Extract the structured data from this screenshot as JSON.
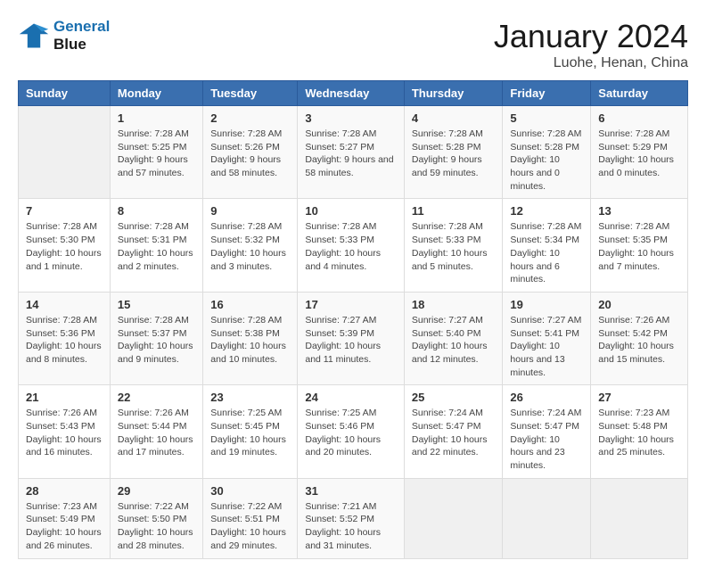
{
  "logo": {
    "line1": "General",
    "line2": "Blue"
  },
  "title": "January 2024",
  "location": "Luohe, Henan, China",
  "weekdays": [
    "Sunday",
    "Monday",
    "Tuesday",
    "Wednesday",
    "Thursday",
    "Friday",
    "Saturday"
  ],
  "weeks": [
    [
      {
        "day": null,
        "info": null
      },
      {
        "day": "1",
        "sunrise": "7:28 AM",
        "sunset": "5:25 PM",
        "daylight": "9 hours and 57 minutes."
      },
      {
        "day": "2",
        "sunrise": "7:28 AM",
        "sunset": "5:26 PM",
        "daylight": "9 hours and 58 minutes."
      },
      {
        "day": "3",
        "sunrise": "7:28 AM",
        "sunset": "5:27 PM",
        "daylight": "9 hours and 58 minutes."
      },
      {
        "day": "4",
        "sunrise": "7:28 AM",
        "sunset": "5:28 PM",
        "daylight": "9 hours and 59 minutes."
      },
      {
        "day": "5",
        "sunrise": "7:28 AM",
        "sunset": "5:28 PM",
        "daylight": "10 hours and 0 minutes."
      },
      {
        "day": "6",
        "sunrise": "7:28 AM",
        "sunset": "5:29 PM",
        "daylight": "10 hours and 0 minutes."
      }
    ],
    [
      {
        "day": "7",
        "sunrise": "7:28 AM",
        "sunset": "5:30 PM",
        "daylight": "10 hours and 1 minute."
      },
      {
        "day": "8",
        "sunrise": "7:28 AM",
        "sunset": "5:31 PM",
        "daylight": "10 hours and 2 minutes."
      },
      {
        "day": "9",
        "sunrise": "7:28 AM",
        "sunset": "5:32 PM",
        "daylight": "10 hours and 3 minutes."
      },
      {
        "day": "10",
        "sunrise": "7:28 AM",
        "sunset": "5:33 PM",
        "daylight": "10 hours and 4 minutes."
      },
      {
        "day": "11",
        "sunrise": "7:28 AM",
        "sunset": "5:33 PM",
        "daylight": "10 hours and 5 minutes."
      },
      {
        "day": "12",
        "sunrise": "7:28 AM",
        "sunset": "5:34 PM",
        "daylight": "10 hours and 6 minutes."
      },
      {
        "day": "13",
        "sunrise": "7:28 AM",
        "sunset": "5:35 PM",
        "daylight": "10 hours and 7 minutes."
      }
    ],
    [
      {
        "day": "14",
        "sunrise": "7:28 AM",
        "sunset": "5:36 PM",
        "daylight": "10 hours and 8 minutes."
      },
      {
        "day": "15",
        "sunrise": "7:28 AM",
        "sunset": "5:37 PM",
        "daylight": "10 hours and 9 minutes."
      },
      {
        "day": "16",
        "sunrise": "7:28 AM",
        "sunset": "5:38 PM",
        "daylight": "10 hours and 10 minutes."
      },
      {
        "day": "17",
        "sunrise": "7:27 AM",
        "sunset": "5:39 PM",
        "daylight": "10 hours and 11 minutes."
      },
      {
        "day": "18",
        "sunrise": "7:27 AM",
        "sunset": "5:40 PM",
        "daylight": "10 hours and 12 minutes."
      },
      {
        "day": "19",
        "sunrise": "7:27 AM",
        "sunset": "5:41 PM",
        "daylight": "10 hours and 13 minutes."
      },
      {
        "day": "20",
        "sunrise": "7:26 AM",
        "sunset": "5:42 PM",
        "daylight": "10 hours and 15 minutes."
      }
    ],
    [
      {
        "day": "21",
        "sunrise": "7:26 AM",
        "sunset": "5:43 PM",
        "daylight": "10 hours and 16 minutes."
      },
      {
        "day": "22",
        "sunrise": "7:26 AM",
        "sunset": "5:44 PM",
        "daylight": "10 hours and 17 minutes."
      },
      {
        "day": "23",
        "sunrise": "7:25 AM",
        "sunset": "5:45 PM",
        "daylight": "10 hours and 19 minutes."
      },
      {
        "day": "24",
        "sunrise": "7:25 AM",
        "sunset": "5:46 PM",
        "daylight": "10 hours and 20 minutes."
      },
      {
        "day": "25",
        "sunrise": "7:24 AM",
        "sunset": "5:47 PM",
        "daylight": "10 hours and 22 minutes."
      },
      {
        "day": "26",
        "sunrise": "7:24 AM",
        "sunset": "5:47 PM",
        "daylight": "10 hours and 23 minutes."
      },
      {
        "day": "27",
        "sunrise": "7:23 AM",
        "sunset": "5:48 PM",
        "daylight": "10 hours and 25 minutes."
      }
    ],
    [
      {
        "day": "28",
        "sunrise": "7:23 AM",
        "sunset": "5:49 PM",
        "daylight": "10 hours and 26 minutes."
      },
      {
        "day": "29",
        "sunrise": "7:22 AM",
        "sunset": "5:50 PM",
        "daylight": "10 hours and 28 minutes."
      },
      {
        "day": "30",
        "sunrise": "7:22 AM",
        "sunset": "5:51 PM",
        "daylight": "10 hours and 29 minutes."
      },
      {
        "day": "31",
        "sunrise": "7:21 AM",
        "sunset": "5:52 PM",
        "daylight": "10 hours and 31 minutes."
      },
      {
        "day": null,
        "info": null
      },
      {
        "day": null,
        "info": null
      },
      {
        "day": null,
        "info": null
      }
    ]
  ],
  "labels": {
    "sunrise": "Sunrise:",
    "sunset": "Sunset:",
    "daylight": "Daylight:"
  }
}
